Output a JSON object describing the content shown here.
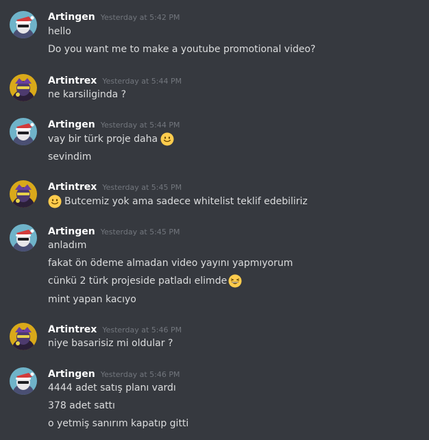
{
  "colors": {
    "background": "#36393f",
    "username": "#ffffff",
    "timestamp": "#72767d",
    "text": "#dcddde"
  },
  "messages": [
    {
      "author": "Artingen",
      "timestamp": "Yesterday at 5:42 PM",
      "avatar": "artingen-avatar",
      "lines": [
        {
          "text": "hello"
        },
        {
          "text": "Do you want me to make a youtube promotional video?"
        }
      ]
    },
    {
      "author": "Artintrex",
      "timestamp": "Yesterday at 5:44 PM",
      "avatar": "artintrex-avatar",
      "lines": [
        {
          "text": "ne karsiliginda ?"
        }
      ]
    },
    {
      "author": "Artingen",
      "timestamp": "Yesterday at 5:44 PM",
      "avatar": "artingen-avatar",
      "lines": [
        {
          "text": "vay bir türk proje daha",
          "emoji_after": "slightly-smiling-face-icon"
        },
        {
          "text": "sevindim"
        }
      ]
    },
    {
      "author": "Artintrex",
      "timestamp": "Yesterday at 5:45 PM",
      "avatar": "artintrex-avatar",
      "lines": [
        {
          "text": "Butcemiz yok ama sadece whitelist teklif edebiliriz",
          "emoji_before": "slightly-smiling-face-icon"
        }
      ]
    },
    {
      "author": "Artingen",
      "timestamp": "Yesterday at 5:45 PM",
      "avatar": "artingen-avatar",
      "lines": [
        {
          "text": "anladım"
        },
        {
          "text": "fakat ön ödeme almadan video yayını yapmıyorum"
        },
        {
          "text": "cünkü 2 türk projeside patladı elimde",
          "emoji_after": "grinning-squinting-face-icon"
        },
        {
          "text": "mint yapan kacıyo"
        }
      ]
    },
    {
      "author": "Artintrex",
      "timestamp": "Yesterday at 5:46 PM",
      "avatar": "artintrex-avatar",
      "lines": [
        {
          "text": "niye basarisiz mi oldular ?"
        }
      ]
    },
    {
      "author": "Artingen",
      "timestamp": "Yesterday at 5:46 PM",
      "avatar": "artingen-avatar",
      "lines": [
        {
          "text": "4444 adet satış planı vardı"
        },
        {
          "text": "378 adet sattı"
        },
        {
          "text": "o yetmiş sanırım kapatıp gitti"
        }
      ]
    }
  ]
}
